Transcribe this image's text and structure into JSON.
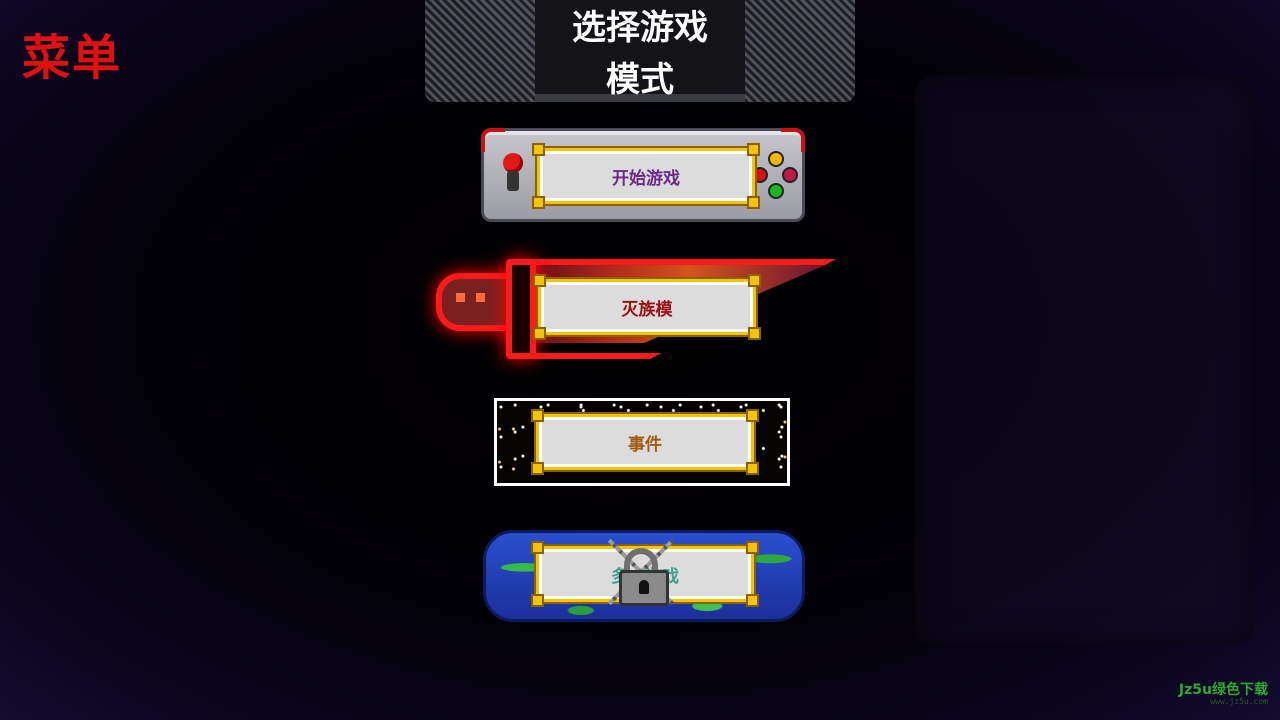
{
  "menu": {
    "title": "菜单"
  },
  "header": {
    "line1": "选择游戏",
    "line2": "模式"
  },
  "modes": [
    {
      "label": "开始游戏",
      "color": "#6a2a8a",
      "locked": false
    },
    {
      "label": "灭族模",
      "color": "#9a1010",
      "locked": false
    },
    {
      "label": "事件",
      "color": "#a05a10",
      "locked": false
    },
    {
      "label": "多人游戏",
      "color": "#3aa08a",
      "locked": true
    }
  ],
  "icons": {
    "lock": "padlock-icon"
  },
  "watermark": {
    "text": "Jz5u绿色下载",
    "sub": "www.jz5u.com"
  }
}
